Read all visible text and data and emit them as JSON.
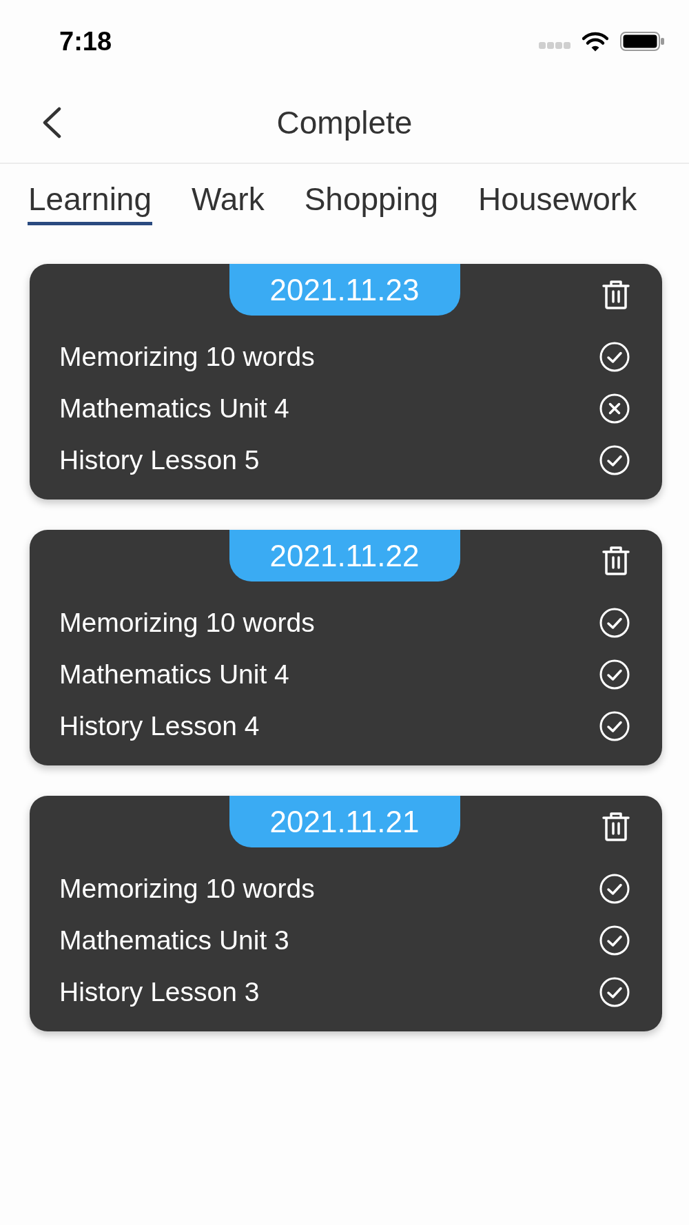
{
  "status_bar": {
    "time": "7:18"
  },
  "header": {
    "title": "Complete"
  },
  "tabs": [
    {
      "label": "Learning",
      "selected": true
    },
    {
      "label": "Wark",
      "selected": false
    },
    {
      "label": "Shopping",
      "selected": false
    },
    {
      "label": "Housework",
      "selected": false
    }
  ],
  "cards": [
    {
      "date": "2021.11.23",
      "tasks": [
        {
          "name": "Memorizing 10 words",
          "done": true
        },
        {
          "name": "Mathematics Unit 4",
          "done": false
        },
        {
          "name": "History Lesson 5",
          "done": true
        }
      ]
    },
    {
      "date": "2021.11.22",
      "tasks": [
        {
          "name": "Memorizing 10 words",
          "done": true
        },
        {
          "name": "Mathematics Unit 4",
          "done": true
        },
        {
          "name": "History Lesson 4",
          "done": true
        }
      ]
    },
    {
      "date": "2021.11.21",
      "tasks": [
        {
          "name": "Memorizing 10 words",
          "done": true
        },
        {
          "name": "Mathematics Unit 3",
          "done": true
        },
        {
          "name": "History Lesson 3",
          "done": true
        }
      ]
    }
  ]
}
